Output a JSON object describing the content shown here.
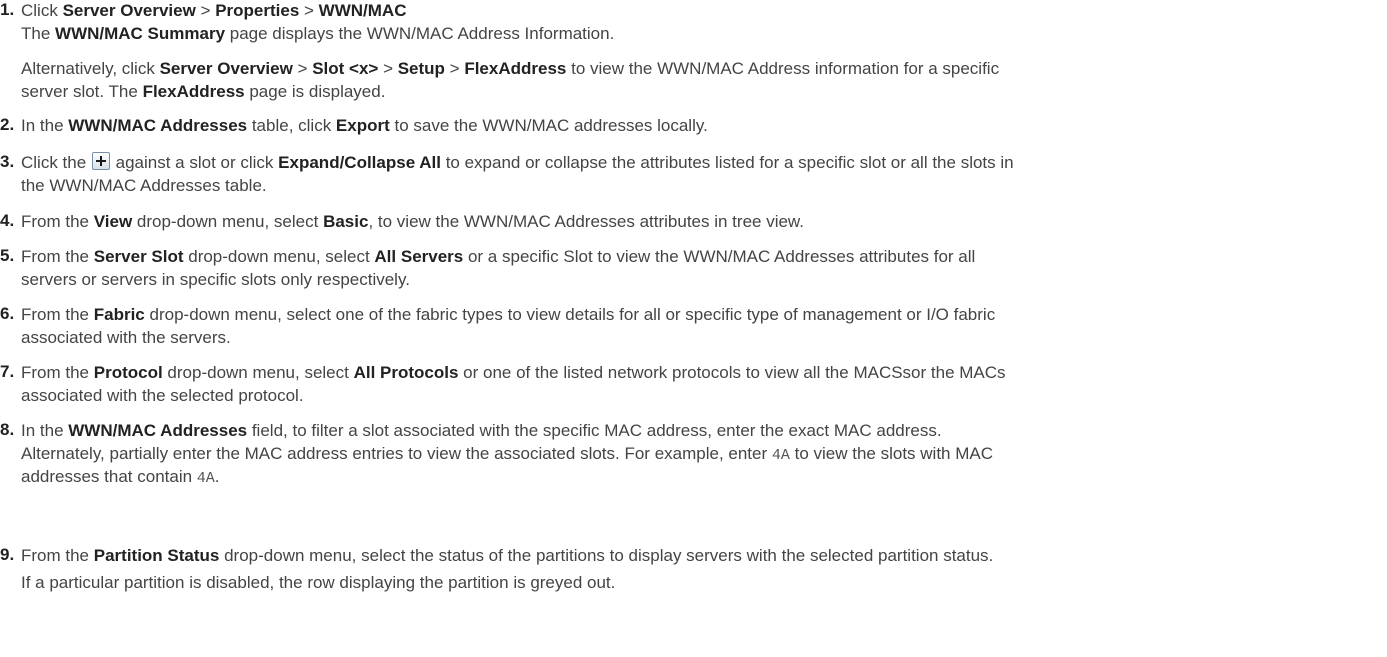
{
  "steps": [
    {
      "number": "1.",
      "lines": [
        {
          "t1": "Click ",
          "b1": "Server Overview",
          "t2": " > ",
          "b2": "Properties",
          "t3": " > ",
          "b3": "WWN/MAC"
        },
        {
          "t1": "The ",
          "b1": "WWN/MAC Summary",
          "t2": " page displays the WWN/MAC Address Information."
        },
        {
          "t1": "Alternatively, click ",
          "b1": "Server Overview",
          "t2": " > ",
          "b2": "Slot <x>",
          "t3": " > ",
          "b3": "Setup",
          "t4": " > ",
          "b4": "FlexAddress",
          "t5": " to view the WWN/MAC Address information for a specific"
        },
        {
          "t1": "server slot. The ",
          "b1": "FlexAddress",
          "t2": " page is displayed."
        }
      ]
    },
    {
      "number": "2.",
      "lines": [
        {
          "t1": "In the ",
          "b1": "WWN/MAC Addresses",
          "t2": " table, click ",
          "b2": "Export",
          "t3": " to save the WWN/MAC addresses locally."
        }
      ]
    },
    {
      "number": "3.",
      "lines": [
        {
          "t1": "Click the ",
          "t2": " against a slot or click ",
          "b1": "Expand/Collapse All",
          "t3": " to expand or collapse the attributes listed for a specific slot or all the slots in"
        },
        {
          "t1": "the WWN/MAC Addresses table."
        }
      ]
    },
    {
      "number": "4.",
      "lines": [
        {
          "t1": "From the ",
          "b1": "View",
          "t2": " drop-down menu, select ",
          "b2": "Basic",
          "t3": ", to view the WWN/MAC Addresses attributes in tree view."
        }
      ]
    },
    {
      "number": "5.",
      "lines": [
        {
          "t1": "From the ",
          "b1": "Server Slot",
          "t2": " drop-down menu, select ",
          "b2": "All Servers",
          "t3": " or a specific Slot to view the WWN/MAC Addresses attributes for all"
        },
        {
          "t1": "servers or servers in specific slots only respectively."
        }
      ]
    },
    {
      "number": "6.",
      "lines": [
        {
          "t1": "From the ",
          "b1": "Fabric",
          "t2": " drop-down menu, select one of the fabric types to view details for all or specific type of management or I/O fabric"
        },
        {
          "t1": "associated with the servers."
        }
      ]
    },
    {
      "number": "7.",
      "lines": [
        {
          "t1": "From the ",
          "b1": "Protocol",
          "t2": " drop-down menu, select ",
          "b2": "All Protocols",
          "t3": " or one of the listed network protocols to view all the MACSsor the MACs"
        },
        {
          "t1": "associated with the selected protocol."
        }
      ]
    },
    {
      "number": "8.",
      "lines": [
        {
          "t1": "In the ",
          "b1": "WWN/MAC Addresses",
          "t2": " field, to filter a slot associated with the specific MAC address, enter the exact MAC address."
        },
        {
          "t1": "Alternately, partially enter the MAC address entries to view the associated slots. For example, enter ",
          "m1": "4A",
          "t2": " to view the slots with MAC"
        },
        {
          "t1": "addresses that contain ",
          "m1": "4A",
          "t2": "."
        }
      ]
    },
    {
      "number": "9.",
      "lines": [
        {
          "t1": "From the ",
          "b1": "Partition Status",
          "t2": " drop-down menu, select the status of the partitions to display servers with the selected partition status."
        },
        {
          "t1": "If a particular partition is disabled, the row displaying the partition is greyed out."
        }
      ]
    }
  ],
  "icons": {
    "expand": "plus-expand-icon"
  }
}
